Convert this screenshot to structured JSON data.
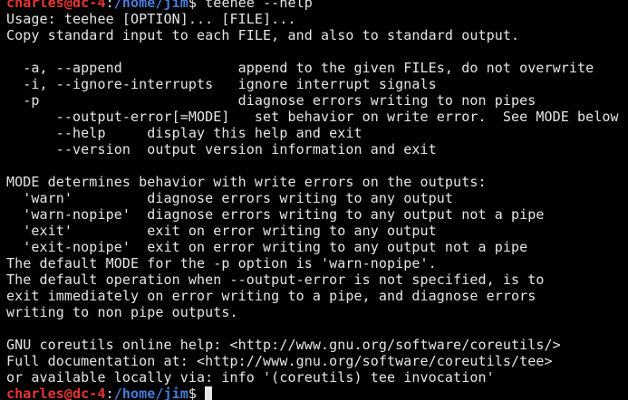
{
  "prompt_top": {
    "user_host": "charles@dc-4",
    "separator": ":",
    "path": "/home/jim",
    "symbol": "$",
    "command": " teehee --help"
  },
  "help_lines": [
    "Usage: teehee [OPTION]... [FILE]...",
    "Copy standard input to each FILE, and also to standard output.",
    "",
    "  -a, --append              append to the given FILEs, do not overwrite",
    "  -i, --ignore-interrupts   ignore interrupt signals",
    "  -p                        diagnose errors writing to non pipes",
    "      --output-error[=MODE]   set behavior on write error.  See MODE below",
    "      --help     display this help and exit",
    "      --version  output version information and exit",
    "",
    "MODE determines behavior with write errors on the outputs:",
    "  'warn'         diagnose errors writing to any output",
    "  'warn-nopipe'  diagnose errors writing to any output not a pipe",
    "  'exit'         exit on error writing to any output",
    "  'exit-nopipe'  exit on error writing to any output not a pipe",
    "The default MODE for the -p option is 'warn-nopipe'.",
    "The default operation when --output-error is not specified, is to",
    "exit immediately on error writing to a pipe, and diagnose errors",
    "writing to non pipe outputs.",
    "",
    "GNU coreutils online help: <http://www.gnu.org/software/coreutils/>",
    "Full documentation at: <http://www.gnu.org/software/coreutils/tee>",
    "or available locally via: info '(coreutils) tee invocation'"
  ],
  "prompt_bottom": {
    "user_host": "charles@dc-4",
    "separator": ":",
    "path": "/home/jim",
    "symbol": "$",
    "command": " "
  },
  "colors": {
    "background": "#000000",
    "text": "#e6e6e6",
    "user": "#e83535",
    "path": "#4a7bd8"
  }
}
